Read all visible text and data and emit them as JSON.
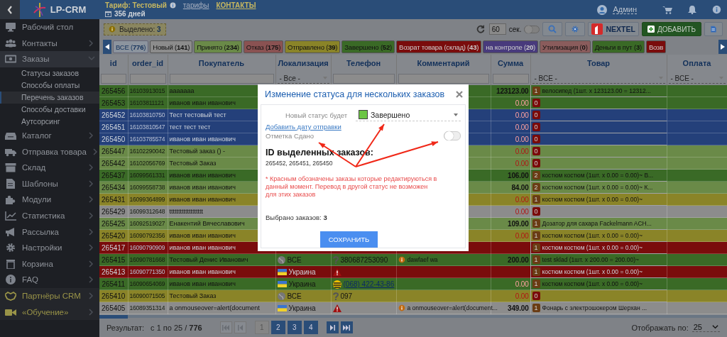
{
  "header": {
    "tariff": "Тариф: Тестовый",
    "tariff_link": "тарифы",
    "contacts_link": "КОНТАКТЫ",
    "days": "356 дней",
    "user": "Админ"
  },
  "sidebar": {
    "logo": "LP-CRM",
    "items": [
      {
        "label": "Рабочий стол",
        "kind": "link",
        "selected": false
      },
      {
        "label": "Контакты",
        "kind": "group",
        "selected": false,
        "expanded": false
      },
      {
        "label": "Заказы",
        "kind": "group",
        "selected": true,
        "expanded": true,
        "children": [
          {
            "label": "Статусы заказов",
            "selected": false
          },
          {
            "label": "Способы оплаты",
            "selected": false
          },
          {
            "label": "Перечень заказов",
            "selected": true
          },
          {
            "label": "Способы доставки",
            "selected": false
          },
          {
            "label": "Аутсорсинг",
            "selected": false
          }
        ]
      },
      {
        "label": "Каталог",
        "kind": "group",
        "selected": false,
        "expanded": false
      },
      {
        "label": "Отправка товара",
        "kind": "group",
        "selected": false,
        "expanded": false
      },
      {
        "label": "Склад",
        "kind": "group",
        "selected": false,
        "expanded": false
      },
      {
        "label": "Шаблоны",
        "kind": "group",
        "selected": false,
        "expanded": false
      },
      {
        "label": "Модули",
        "kind": "group",
        "selected": false,
        "expanded": false
      },
      {
        "label": "Статистика",
        "kind": "group",
        "selected": false,
        "expanded": false
      },
      {
        "label": "Рассылка",
        "kind": "group",
        "selected": false,
        "expanded": false
      },
      {
        "label": "Настройки",
        "kind": "group",
        "selected": false,
        "expanded": false
      },
      {
        "label": "Корзина",
        "kind": "group",
        "selected": false,
        "expanded": false
      },
      {
        "label": "FAQ",
        "kind": "group",
        "selected": false,
        "expanded": false
      },
      {
        "label": "Партнёры CRM",
        "kind": "promo",
        "selected": false,
        "expanded": false
      },
      {
        "label": "«Обучение»",
        "kind": "promo",
        "selected": false,
        "expanded": false
      }
    ]
  },
  "toolbar": {
    "selected_badge": "Выделено: **3**",
    "refresh_interval": "60",
    "interval_unit": "сек.",
    "auto_refresh_on": false,
    "nextel": "NEXTEL",
    "add_button": "ДОБАВИТЬ"
  },
  "status_tabs": [
    {
      "label": "ВСЕ (**776**)",
      "selected": true,
      "color": "#8c949e"
    },
    {
      "label": "Новый (**141**)",
      "selected": false,
      "color": "#8c8c8c"
    },
    {
      "label": "Принято (**234**)",
      "selected": false,
      "color": "#6a8a48"
    },
    {
      "label": "Отказ (**175**)",
      "selected": false,
      "color": "#8a5252"
    },
    {
      "label": "Отправлено (**39**)",
      "selected": false,
      "color": "#8a8428"
    },
    {
      "label": "Завершено (**52**)",
      "selected": false,
      "color": "#3a6a26"
    },
    {
      "label": "Возрат товара (склад) (**43**)",
      "selected": false,
      "color": "#7a0c0c"
    },
    {
      "label": "на контроле (**20**)",
      "selected": false,
      "color": "#483a7c"
    },
    {
      "label": "Утилизация (**0**)",
      "selected": false,
      "color": "#8a5c5c"
    },
    {
      "label": "Деньги в пут (**3**)",
      "selected": false,
      "color": "#3a6a26"
    },
    {
      "label": "Возв",
      "selected": false,
      "color": "#7a0c0c"
    }
  ],
  "table": {
    "columns": [
      "id",
      "order_id",
      "Покупатель",
      "Локализация",
      "Телефон",
      "Комментарий",
      "Сумма",
      "Товар",
      "Оплата"
    ],
    "filters": [
      {
        "kind": "input"
      },
      {
        "kind": "input"
      },
      {
        "kind": "input"
      },
      {
        "kind": "select",
        "value": "- Все -"
      },
      {
        "kind": "input"
      },
      {
        "kind": "input"
      },
      {
        "kind": "input"
      },
      {
        "kind": "select",
        "value": "- ВСЕ -"
      },
      {
        "kind": "select",
        "value": "- ВСЕ -"
      }
    ],
    "rows": [
      {
        "id": "265456",
        "order_id": "16103913015",
        "customer": "aaaaaaa",
        "sum": "123123.00",
        "sum_red": false,
        "items": "1",
        "items_red": false,
        "product": "велосипед (1шт. x 123123.00 = 12312...",
        "color": "#3a6a26"
      },
      {
        "id": "265453",
        "order_id": "16103811121",
        "customer": "иванов иван иванович",
        "sum": "0.00",
        "sum_red": true,
        "items": "0",
        "items_red": true,
        "color": "#3a6a26"
      },
      {
        "id": "265452",
        "order_id": "16103810750",
        "customer": "Тест тестовый тест",
        "sum": "0.00",
        "sum_red": true,
        "items": "0",
        "items_red": true,
        "color": "#24407a"
      },
      {
        "id": "265451",
        "order_id": "16103810547",
        "customer": "тест тест тест",
        "sum": "0.00",
        "sum_red": true,
        "items": "0",
        "items_red": true,
        "color": "#24407a"
      },
      {
        "id": "265450",
        "order_id": "16103785574",
        "customer": "иванов иван иванович",
        "sum": "0.00",
        "sum_red": true,
        "items": "0",
        "items_red": true,
        "color": "#24407a"
      },
      {
        "id": "265447",
        "order_id": "16102290042",
        "customer": "Тестовый заказ () -",
        "sum": "0.00",
        "sum_red": true,
        "items": "0",
        "items_red": true,
        "color": "#6a8a48"
      },
      {
        "id": "265442",
        "order_id": "16102056769",
        "customer": "Тестовый Заказ",
        "sum": "0.00",
        "sum_red": true,
        "items": "0",
        "items_red": true,
        "color": "#6a8a48"
      },
      {
        "id": "265437",
        "order_id": "16099561331",
        "customer": "иванов иван иванович",
        "sum": "106.00",
        "sum_red": false,
        "items": "2",
        "items_red": false,
        "product": "костюм костюм (1шт. x 0.00 = 0.00)~ В...",
        "color": "#3a6a26"
      },
      {
        "id": "265434",
        "order_id": "16099558738",
        "customer": "иванов иван иванович",
        "sum": "84.00",
        "sum_red": false,
        "items": "2",
        "items_red": false,
        "product": "костюм костюм (1шт. x 0.00 = 0.00)~ К...",
        "color": "#6a8a48"
      },
      {
        "id": "265431",
        "order_id": "16099364899",
        "customer": "иванов иван иванович",
        "sum": "0.00",
        "sum_red": true,
        "items": "1",
        "items_red": false,
        "product": "костюм костюм (1шт. x 0.00 = 0.00)~",
        "color": "#8a8428"
      },
      {
        "id": "265429",
        "order_id": "16099312648",
        "customer": "ttttttttttttttttttt",
        "sum": "0.00",
        "sum_red": true,
        "items": "0",
        "items_red": true,
        "color": "#8c8c8c"
      },
      {
        "id": "265425",
        "order_id": "16092519027",
        "customer": "Енакентий Вячеславович",
        "sum": "109.00",
        "sum_red": false,
        "items": "1",
        "items_red": false,
        "product": "Дозатор для сахара Fackelmann ACH...",
        "color": "#6a8a48"
      },
      {
        "id": "265420",
        "order_id": "16090792356",
        "customer": "иванов иван иванович",
        "sum": "0.00",
        "sum_red": true,
        "items": "1",
        "items_red": false,
        "product": "костюм костюм (1шт. x 0.00 = 0.00)~",
        "color": "#8a8428"
      },
      {
        "id": "265417",
        "order_id": "16090790909",
        "customer": "иванов иван иванович",
        "items": "1",
        "items_red": false,
        "product": "костюм костюм (1шт. x 0.00 = 0.00)~",
        "color": "#7a0c0c"
      },
      {
        "id": "265415",
        "order_id": "16090781668",
        "customer": "Тестовый Денис Иванович",
        "location": {
          "kind": "globe",
          "text": "ВСЕ"
        },
        "phone": {
          "kind": "unknown",
          "text": "380687253090"
        },
        "comment": "dawfaef wa",
        "sum": "200.00",
        "sum_red": false,
        "items": "1",
        "items_red": false,
        "product": "test sklad (1шт. x 200.00 = 200.00)~",
        "color": "#3a6a26"
      },
      {
        "id": "265413",
        "order_id": "16090771350",
        "customer": "иванов иван иванович",
        "location": {
          "kind": "flag",
          "text": "Украина"
        },
        "phone": {
          "kind": "warning"
        },
        "items": "1",
        "items_red": false,
        "product": "костюм костюм (1шт. x 0.00 = 0.00)~",
        "color": "#7a0c0c"
      },
      {
        "id": "265411",
        "order_id": "16090654069",
        "customer": "иванов иван иванович",
        "location": {
          "kind": "flag",
          "text": "Украина"
        },
        "phone": {
          "kind": "operator",
          "text": "(068) 422-43-86"
        },
        "sum": "0.00",
        "sum_red": true,
        "items": "1",
        "items_red": false,
        "product": "костюм костюм (1шт. x 0.00 = 0.00)~",
        "color": "#3a6a26"
      },
      {
        "id": "265410",
        "order_id": "16090071505",
        "customer": "Тестовый Заказ",
        "location": {
          "kind": "globe",
          "text": "ВСЕ"
        },
        "phone": {
          "kind": "unknown",
          "text": "097"
        },
        "sum": "0.00",
        "sum_red": true,
        "items": "0",
        "items_red": true,
        "color": "#8a8428"
      },
      {
        "id": "265405",
        "order_id": "16089351314",
        "customer": "a onmouseover=alert(document",
        "location": {
          "kind": "flag",
          "text": "Украина"
        },
        "phone": {
          "kind": "warning"
        },
        "comment": "a onmouseover=alert(document...",
        "sum": "349.00",
        "sum_red": false,
        "items": "1",
        "items_red": false,
        "product": "Фонарь с электрошокером Шерхан ...",
        "color": "#8c8c8c"
      }
    ]
  },
  "footer": {
    "result_label": "Результат:",
    "result_range": "с 1 по 25 / **776**",
    "back_disabled": true,
    "pages": [
      {
        "label": "1",
        "selected": true
      },
      {
        "label": "2",
        "selected": false
      },
      {
        "label": "3",
        "selected": false
      },
      {
        "label": "4",
        "selected": false
      }
    ],
    "per_page_label": "Отображать по:",
    "per_page": "25"
  },
  "modal": {
    "title": "Изменение статуса для нескольких заказов",
    "status_label": "Новый статус будет",
    "status_value": "Завершено",
    "date_link": "Добавить дату отправки",
    "handed_label": "Отметка Сдано",
    "handed_on": false,
    "ids_heading": "ID выделенных заказов:",
    "ids": "265452, 265451, 265450",
    "note": "* Красным обозначены заказы которые редактируються в данный момент. Перевод в другой статус не возможен для этих заказов",
    "count": "Выбрано заказов: **3**",
    "save": "СОХРАНИТЬ"
  }
}
